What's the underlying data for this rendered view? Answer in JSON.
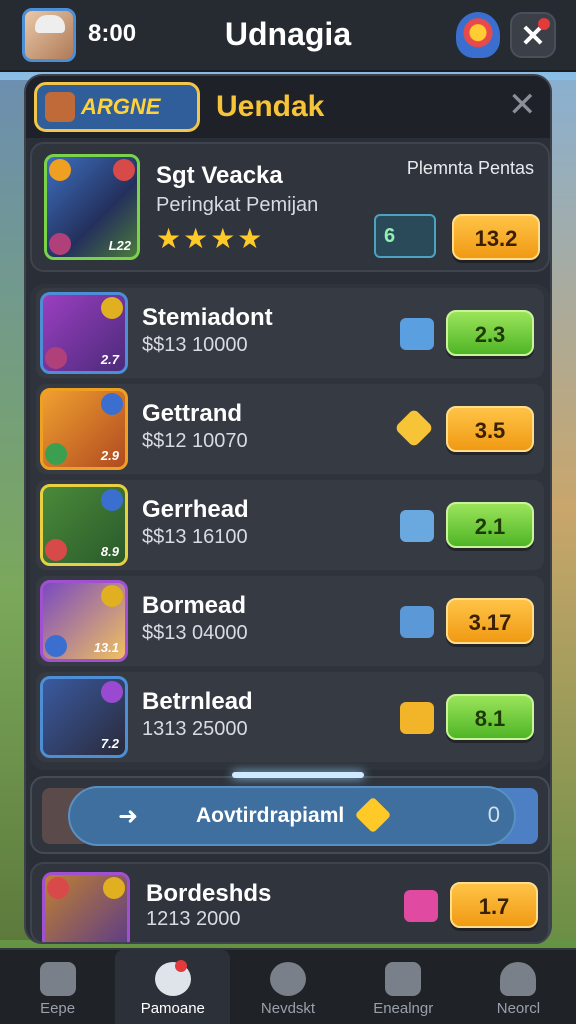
{
  "header": {
    "time": "8:00",
    "title": "Udnagia"
  },
  "panel": {
    "tab_label": "ARGNE",
    "section_title": "Uendak",
    "featured": {
      "name": "Sgt Veacka",
      "subtitle": "Peringkat Pemijan",
      "right_label": "Plemnta Pentas",
      "level": "L22",
      "stars": "★★★★",
      "gem_label": "6",
      "value": "13.2"
    },
    "rows": [
      {
        "name": "Stemiadont",
        "price": "$$13 10000",
        "level": "2.7",
        "value": "2.3",
        "value_color": "green",
        "gem_color": "#5aa0e0"
      },
      {
        "name": "Gettrand",
        "price": "$$12 10070",
        "level": "2.9",
        "value": "3.5",
        "value_color": "orange",
        "gem_color": "#f7c437"
      },
      {
        "name": "Gerrhead",
        "price": "$$13 16100",
        "level": "8.9",
        "value": "2.1",
        "value_color": "green",
        "gem_color": "#6aa8e0"
      },
      {
        "name": "Bormead",
        "price": "$$13 04000",
        "level": "13.1",
        "value": "3.17",
        "value_color": "orange",
        "gem_color": "#5a98d8"
      },
      {
        "name": "Betrnlead",
        "price": "1313 25000",
        "level": "7.2",
        "value": "8.1",
        "value_color": "green",
        "gem_color": "#f2b52a"
      }
    ],
    "banner": {
      "text": "Aovtirdrapiaml",
      "count": "0"
    },
    "last_row": {
      "name": "Bordeshds",
      "price": "1213 2000",
      "value": "1.7",
      "value_color": "orange",
      "gem_color": "#e04aa0"
    }
  },
  "nav": [
    {
      "label": "Eepe",
      "icon": "home-icon"
    },
    {
      "label": "Pamoane",
      "icon": "chat-icon"
    },
    {
      "label": "Nevdskt",
      "icon": "refresh-icon"
    },
    {
      "label": "Enealngr",
      "icon": "trophy-icon"
    },
    {
      "label": "Neorcl",
      "icon": "profile-icon"
    }
  ]
}
